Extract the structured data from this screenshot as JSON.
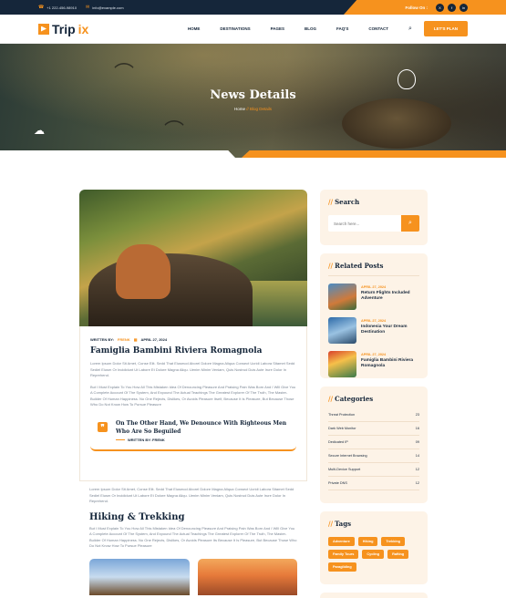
{
  "topbar": {
    "phone": "+1 222-456-98910",
    "email": "info@example.com",
    "follow_label": "Follow On :",
    "social": [
      "X",
      "f",
      "in"
    ]
  },
  "nav": {
    "logo_a": "Trip",
    "logo_b": "ix",
    "items": [
      "HOME",
      "DESTINATIONS",
      "PAGES",
      "BLOG",
      "FAQ'S",
      "CONTACT"
    ],
    "cta": "LET'S PLAN"
  },
  "hero": {
    "title": "News Details",
    "crumb_home": "Home",
    "crumb_sep": "//",
    "crumb_current": "Blog Details"
  },
  "article": {
    "meta_written": "WRITTEN BY:",
    "meta_author": "FRENK",
    "meta_date": "APRIL 27, 2024",
    "title": "Famiglia Bambini Riviera Romagnola",
    "p1": "Lorem Ipsum Dolor Sit Amet, Conse Elit. Sedd That Eiusmod Aborel Dolore Magna Aliqua Consect Ucridi Labora Sitamet Sedd Sediel Eiusm Or Incididunt Ut Labore Et Dolore Magna Aliqu. Uenim Minim Veniam, Quis Nostrud Duis Aute Irure Dolor In Reprehend.",
    "p2": "But I Must Explain To You How All This Mistaken Idea Of Denouncing Pleasure And Praising Pain Was Born And I Will Give You A Complete Account Of The System, And Expound The Actual Teachings The Greatest Explorer Of The Truth, The Master-Builder Of Human Happiness. No One Rejects, Dislikes, Or Avoids Pleasure Itself, Because It Is Pleasure, But Because Those Who Do Not Know How To Pursue Pleasure",
    "quote": "On The Other Hand, We Denounce With Righteous Men Who Are So Beguiled",
    "quote_author": "WRITTEN BY: FRENK",
    "p3": "Lorem Ipsum Dolor Sit Amet, Conse Elit. Sedd That Eiusmod Aborel Dolore Magna Aliqua Consect Ucridi Labora Sitamet Sedd Sediel Eiusm Or Incididunt Ut Labore Et Dolore Magna Aliqu. Uenim Minim Veniam, Quis Nostrud Duis Aute Irure Dolor In Reprehend.",
    "h2": "Hiking & Trekking",
    "p4": "But I Must Explain To You How All This Mistaken Idea Of Denouncing Pleasure And Praising Pain Was Born And I Will Give You A Complete Account Of The System, And Expound The Actual Teachings The Greatest Explorer Of The Truth, The Master-Builder Of Human Happiness. No One Rejects, Dislikes, Or Avoids Pleasure Its Because It Is Pleasure, But Because Those Who Do Not Know How To Pursue Pleasure"
  },
  "sidebar": {
    "search_title": "Search",
    "search_placeholder": "Search here...",
    "related_title": "Related Posts",
    "posts": [
      {
        "date": "APRIL 27, 2024",
        "title": "Return Flights Included Adventure"
      },
      {
        "date": "APRIL 27, 2024",
        "title": "Indonesia Your Dream Destination"
      },
      {
        "date": "APRIL 27, 2024",
        "title": "Famiglia Bambini Riviera Romagnola"
      }
    ],
    "categories_title": "Categories",
    "categories": [
      {
        "name": "Threat Protection",
        "count": "23"
      },
      {
        "name": "Dark Web Monitor",
        "count": "16"
      },
      {
        "name": "Dedicated IP",
        "count": "09"
      },
      {
        "name": "Secure Internet Browsing",
        "count": "14"
      },
      {
        "name": "Multi-Device Support",
        "count": "12"
      },
      {
        "name": "Private DNS",
        "count": "12"
      }
    ],
    "tags_title": "Tags",
    "tags": [
      "Adventure",
      "Hiking",
      "Trekking",
      "Family Tours",
      "Cycling",
      "Rafting",
      "Paragliding"
    ]
  }
}
